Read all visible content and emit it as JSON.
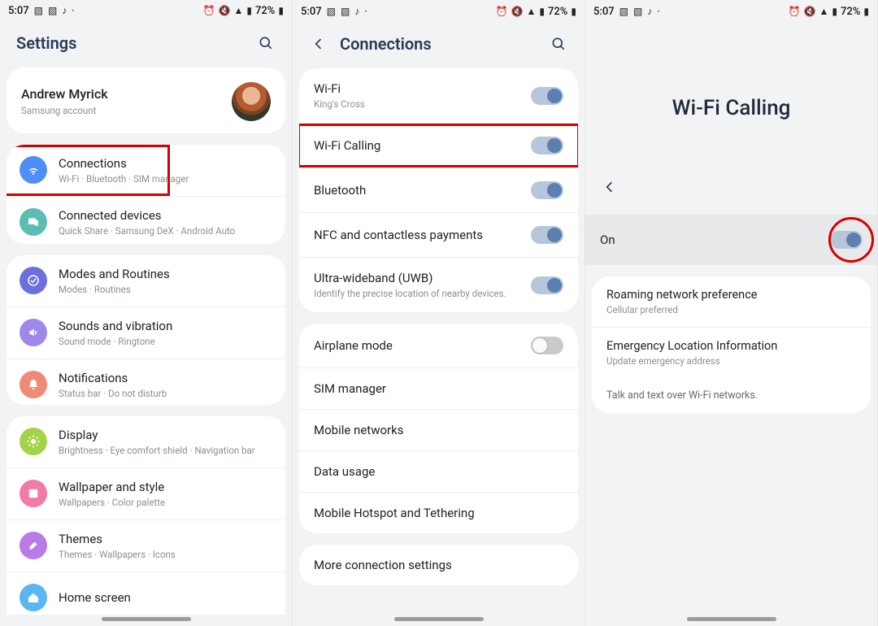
{
  "status": {
    "time": "5:07",
    "battery": "72%"
  },
  "s1": {
    "title": "Settings",
    "account": {
      "name": "Andrew Myrick",
      "sub": "Samsung account"
    },
    "g1": [
      {
        "title": "Connections",
        "sub": "Wi-Fi  ·  Bluetooth  ·  SIM manager",
        "highlight": true
      },
      {
        "title": "Connected devices",
        "sub": "Quick Share  ·  Samsung DeX  ·  Android Auto"
      }
    ],
    "g2": [
      {
        "title": "Modes and Routines",
        "sub": "Modes  ·  Routines"
      },
      {
        "title": "Sounds and vibration",
        "sub": "Sound mode  ·  Ringtone"
      },
      {
        "title": "Notifications",
        "sub": "Status bar  ·  Do not disturb"
      }
    ],
    "g3": [
      {
        "title": "Display",
        "sub": "Brightness  ·  Eye comfort shield  ·  Navigation bar"
      },
      {
        "title": "Wallpaper and style",
        "sub": "Wallpapers  ·  Color palette"
      },
      {
        "title": "Themes",
        "sub": "Themes  ·  Wallpapers  ·  Icons"
      },
      {
        "title": "Home screen",
        "sub": ""
      }
    ]
  },
  "s2": {
    "title": "Connections",
    "g1": [
      {
        "title": "Wi-Fi",
        "sub": "King's Cross",
        "toggle": "on"
      },
      {
        "title": "Wi-Fi Calling",
        "sub": "",
        "toggle": "on",
        "highlight": true
      },
      {
        "title": "Bluetooth",
        "sub": "",
        "toggle": "on"
      },
      {
        "title": "NFC and contactless payments",
        "sub": "",
        "toggle": "on"
      },
      {
        "title": "Ultra-wideband (UWB)",
        "sub": "Identify the precise location of nearby devices.",
        "toggle": "on"
      }
    ],
    "g2": [
      {
        "title": "Airplane mode",
        "toggle": "off"
      },
      {
        "title": "SIM manager"
      },
      {
        "title": "Mobile networks"
      },
      {
        "title": "Data usage"
      },
      {
        "title": "Mobile Hotspot and Tethering"
      }
    ],
    "g3": [
      {
        "title": "More connection settings"
      }
    ]
  },
  "s3": {
    "title": "Wi-Fi Calling",
    "on_label": "On",
    "items": [
      {
        "title": "Roaming network preference",
        "sub": "Cellular preferred"
      },
      {
        "title": "Emergency Location Information",
        "sub": "Update emergency address"
      }
    ],
    "note": "Talk and text over Wi-Fi networks."
  }
}
